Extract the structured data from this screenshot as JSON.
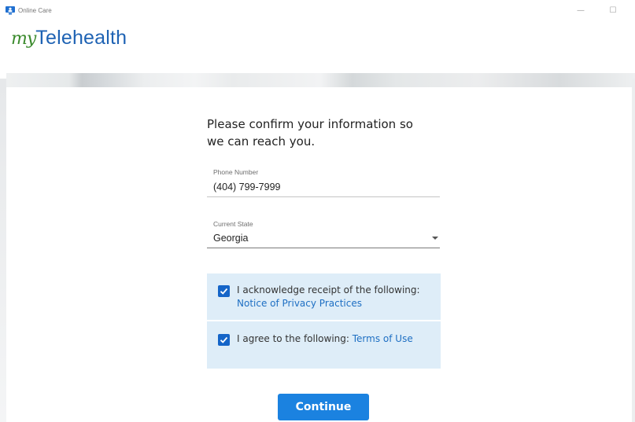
{
  "window": {
    "app_title": "Online Care",
    "app_icon": "online-care-icon",
    "minimize_glyph": "—",
    "maximize_glyph": "☐"
  },
  "logo": {
    "my_text": "my",
    "brand_text": "Telehealth",
    "colors": {
      "my": "#3a8a2c",
      "brand": "#1f63b4"
    }
  },
  "form": {
    "heading_line1": "Please confirm your information so",
    "heading_line2": "we can reach you.",
    "phone": {
      "label": "Phone Number",
      "value": "(404) 799-7999"
    },
    "state": {
      "label": "Current State",
      "value": "Georgia"
    },
    "consents": [
      {
        "checked": true,
        "text": "I acknowledge receipt of the following:",
        "link": "Notice of Privacy Practices"
      },
      {
        "checked": true,
        "text": "I agree to the following: ",
        "link": "Terms of Use"
      }
    ],
    "continue_label": "Continue"
  },
  "colors": {
    "accent": "#1b82e0",
    "checkbox": "#1565c8",
    "consent_bg": "#deedf8",
    "link": "#1e6fc3"
  }
}
